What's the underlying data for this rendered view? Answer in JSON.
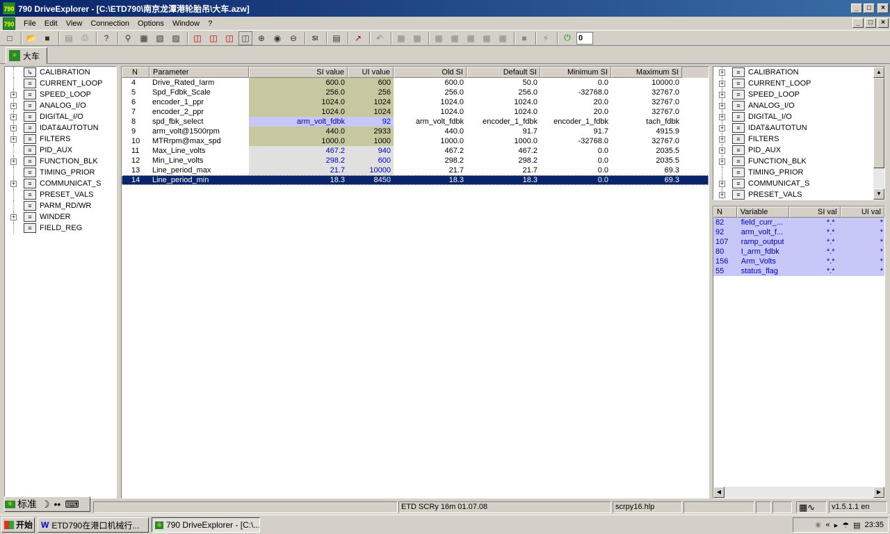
{
  "window": {
    "title": "790 DriveExplorer - [C:\\ETD790\\南京龙潭港轮胎吊\\大车.azw]",
    "app_icon_label": "790",
    "min_glyph": "_",
    "max_glyph": "□",
    "close_glyph": "×"
  },
  "menu": [
    "File",
    "Edit",
    "View",
    "Connection",
    "Options",
    "Window",
    "?"
  ],
  "toolbar": {
    "icons": [
      "new-file-icon",
      "open-folder-icon",
      "save-icon",
      "print-preview-icon",
      "print-icon",
      "help-icon",
      "find-icon",
      "copy-block-icon",
      "paste-block-icon",
      "compare-icon",
      "layout-1-icon",
      "layout-2-icon",
      "layout-3-icon",
      "layout-4-icon",
      "zoom-in-icon",
      "zoom-fit-icon",
      "zoom-out-icon",
      "si-unit-icon",
      "monitor-icon",
      "trend-icon",
      "undo-icon",
      "upload-icon",
      "download-icon",
      "drive-icon",
      "drive-2-icon",
      "drive-3-icon",
      "drive-4-icon",
      "drive-5-icon",
      "stop-icon",
      "flash-icon",
      "power-icon"
    ],
    "value_input": "0"
  },
  "tab": {
    "label": "大车"
  },
  "left_tree": [
    {
      "label": "CALIBRATION",
      "expandable": false
    },
    {
      "label": "CURRENT_LOOP",
      "expandable": false
    },
    {
      "label": "SPEED_LOOP",
      "expandable": true
    },
    {
      "label": "ANALOG_I/O",
      "expandable": true
    },
    {
      "label": "DIGITAL_I/O",
      "expandable": true
    },
    {
      "label": "IDAT&AUTOTUN",
      "expandable": true
    },
    {
      "label": "FILTERS",
      "expandable": true
    },
    {
      "label": "PID_AUX",
      "expandable": false
    },
    {
      "label": "FUNCTION_BLK",
      "expandable": true
    },
    {
      "label": "TIMING_PRIOR",
      "expandable": false
    },
    {
      "label": "COMMUNICAT_S",
      "expandable": true
    },
    {
      "label": "PRESET_VALS",
      "expandable": false
    },
    {
      "label": "PARM_RD/WR",
      "expandable": false
    },
    {
      "label": "WINDER",
      "expandable": true
    },
    {
      "label": "FIELD_REG",
      "expandable": false
    }
  ],
  "grid": {
    "columns": [
      "N",
      "Parameter",
      "SI value",
      "UI value",
      "Old SI",
      "Default SI",
      "Minimum SI",
      "Maximum SI"
    ],
    "rows": [
      {
        "n": "4",
        "param": "Drive_Rated_Iarm",
        "si": "600.0",
        "ui": "600",
        "old": "600.0",
        "def": "50.0",
        "min": "0.0",
        "max": "10000.0",
        "style": "olive",
        "blue": false,
        "selected": false
      },
      {
        "n": "5",
        "param": "Spd_Fdbk_Scale",
        "si": "256.0",
        "ui": "256",
        "old": "256.0",
        "def": "256.0",
        "min": "-32768.0",
        "max": "32767.0",
        "style": "olive",
        "blue": false,
        "selected": false
      },
      {
        "n": "6",
        "param": "encoder_1_ppr",
        "si": "1024.0",
        "ui": "1024",
        "old": "1024.0",
        "def": "1024.0",
        "min": "20.0",
        "max": "32767.0",
        "style": "olive",
        "blue": false,
        "selected": false
      },
      {
        "n": "7",
        "param": "encoder_2_ppr",
        "si": "1024.0",
        "ui": "1024",
        "old": "1024.0",
        "def": "1024.0",
        "min": "20.0",
        "max": "32767.0",
        "style": "olive",
        "blue": false,
        "selected": false
      },
      {
        "n": "8",
        "param": "spd_fbk_select",
        "si": "arm_volt_fdbk",
        "ui": "92",
        "old": "arm_volt_fdbk",
        "def": "encoder_1_fdbk",
        "min": "encoder_1_fdbk",
        "max": "tach_fdbk",
        "style": "lav",
        "blue": true,
        "selected": false
      },
      {
        "n": "9",
        "param": "arm_volt@1500rpm",
        "si": "440.0",
        "ui": "2933",
        "old": "440.0",
        "def": "91.7",
        "min": "91.7",
        "max": "4915.9",
        "style": "olive",
        "blue": false,
        "selected": false
      },
      {
        "n": "10",
        "param": "MTRrpm@max_spd",
        "si": "1000.0",
        "ui": "1000",
        "old": "1000.0",
        "def": "1000.0",
        "min": "-32768.0",
        "max": "32767.0",
        "style": "olive",
        "blue": false,
        "selected": false
      },
      {
        "n": "11",
        "param": "Max_Line_volts",
        "si": "467.2",
        "ui": "940",
        "old": "467.2",
        "def": "467.2",
        "min": "0.0",
        "max": "2035.5",
        "style": "gray",
        "blue": true,
        "selected": false
      },
      {
        "n": "12",
        "param": "Min_Line_volts",
        "si": "298.2",
        "ui": "600",
        "old": "298.2",
        "def": "298.2",
        "min": "0.0",
        "max": "2035.5",
        "style": "gray",
        "blue": true,
        "selected": false
      },
      {
        "n": "13",
        "param": "Line_period_max",
        "si": "21.7",
        "ui": "10000",
        "old": "21.7",
        "def": "21.7",
        "min": "0.0",
        "max": "69.3",
        "style": "gray",
        "blue": true,
        "selected": false
      },
      {
        "n": "14",
        "param": "Line_period_min",
        "si": "18.3",
        "ui": "8450",
        "old": "18.3",
        "def": "18.3",
        "min": "0.0",
        "max": "69.3",
        "style": "gray",
        "blue": true,
        "selected": true
      }
    ]
  },
  "right_tree": [
    {
      "label": "CALIBRATION",
      "expandable": true
    },
    {
      "label": "CURRENT_LOOP",
      "expandable": true
    },
    {
      "label": "SPEED_LOOP",
      "expandable": true
    },
    {
      "label": "ANALOG_I/O",
      "expandable": true
    },
    {
      "label": "DIGITAL_I/O",
      "expandable": true
    },
    {
      "label": "IDAT&AUTOTUN",
      "expandable": true
    },
    {
      "label": "FILTERS",
      "expandable": true
    },
    {
      "label": "PID_AUX",
      "expandable": true
    },
    {
      "label": "FUNCTION_BLK",
      "expandable": true
    },
    {
      "label": "TIMING_PRIOR",
      "expandable": false
    },
    {
      "label": "COMMUNICAT_S",
      "expandable": true
    },
    {
      "label": "PRESET_VALS",
      "expandable": true
    }
  ],
  "watch": {
    "columns": [
      "N",
      "Variable",
      "SI val",
      "UI val"
    ],
    "rows": [
      {
        "n": "82",
        "var": "field_curr_...",
        "si": "*.*",
        "ui": "*"
      },
      {
        "n": "92",
        "var": "arm_volt_f...",
        "si": "*.*",
        "ui": "*"
      },
      {
        "n": "107",
        "var": "ramp_output",
        "si": "*.*",
        "ui": "*"
      },
      {
        "n": "80",
        "var": "I_arm_fdbk",
        "si": "*.*",
        "ui": "*"
      },
      {
        "n": "156",
        "var": "Arm_Volts",
        "si": "*.*",
        "ui": "*"
      },
      {
        "n": "55",
        "var": "status_flag",
        "si": "*.*",
        "ui": "*"
      }
    ]
  },
  "status": {
    "drive": "ETD SCRy 16m 01.07.08",
    "help_file": "scrpy16.hlp",
    "version": "v1.5.1.1 en"
  },
  "ime": {
    "mode": "标准"
  },
  "taskbar": {
    "start": "开始",
    "tasks": [
      "ETD790在港口机械行...",
      "790 DriveExplorer - [C:\\..."
    ],
    "clock": "23:35"
  }
}
